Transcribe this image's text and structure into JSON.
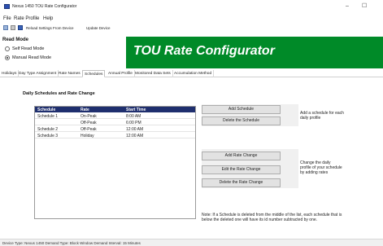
{
  "window": {
    "title": "Nexus 1450 TOU Rate Configurator",
    "controls": {
      "minimize": "–",
      "maximize": "☐"
    }
  },
  "menu": {
    "items": [
      "File",
      "Rate Profile",
      "Help"
    ]
  },
  "toolbar": {
    "items": [
      "Reload Settings From Device",
      "Update Device"
    ]
  },
  "read_mode": {
    "title": "Read Mode",
    "options": [
      {
        "label": "Self Read Mode",
        "selected": false
      },
      {
        "label": "Manual Read Mode",
        "selected": true
      }
    ]
  },
  "banner": {
    "title": "TOU Rate Configurator",
    "color": "#008a28"
  },
  "tabs": {
    "items": [
      "Holidays",
      "Day Type Assignment",
      "Rate Names",
      "Schedules",
      "Annual Profile",
      "Monitored Data Sets",
      "Accumulation Method"
    ],
    "active": "Schedules"
  },
  "schedules": {
    "section_title": "Daily Schedules and Rate Change",
    "columns": [
      "Schedule",
      "Rate",
      "Start Time"
    ],
    "rows": [
      [
        "Schedule 1",
        "On-Peak",
        "8:00 AM"
      ],
      [
        "",
        "Off-Peak",
        "6:00 PM"
      ],
      [
        "Schedule 2",
        "Off-Peak",
        "12:00 AM"
      ],
      [
        "Schedule 3",
        "Holiday",
        "12:00 AM"
      ]
    ],
    "header_color": "#1f2f6e"
  },
  "schedule_actions": {
    "add_schedule": "Add Schedule",
    "delete_schedule": "Delete the Schedule",
    "description": "Add a schedule for each daily profile"
  },
  "rate_actions": {
    "add_rate_change": "Add Rate Change",
    "edit_rate_change": "Edit the Rate Change",
    "delete_rate_change": "Delete the Rate Change",
    "description": "Change the daily profile of your schedule by adding rates"
  },
  "note": "Note: If a Schedule is deleted from the middle of the list, each schedule that is below the deleted one will have its id number subtracted by one.",
  "status": "Device Type: Nexus 1450  Demand Type: Block Window  Demand Interval: 15 Minutes"
}
